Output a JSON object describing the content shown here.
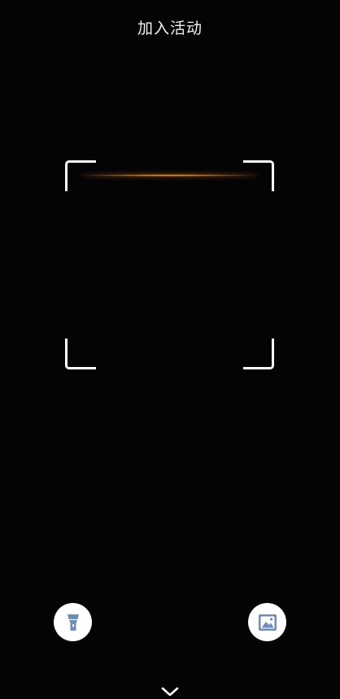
{
  "header": {
    "title": "加入活动"
  },
  "scanner": {
    "corner_color": "#ffffff",
    "scan_line_color": "#e89230"
  },
  "controls": {
    "flashlight_icon": "flashlight-icon",
    "album_icon": "image-icon",
    "close_icon": "chevron-down-icon",
    "icon_color": "#6f8db5",
    "button_color": "#ffffff"
  },
  "colors": {
    "background": "#040306",
    "text": "#f2f2f2"
  }
}
